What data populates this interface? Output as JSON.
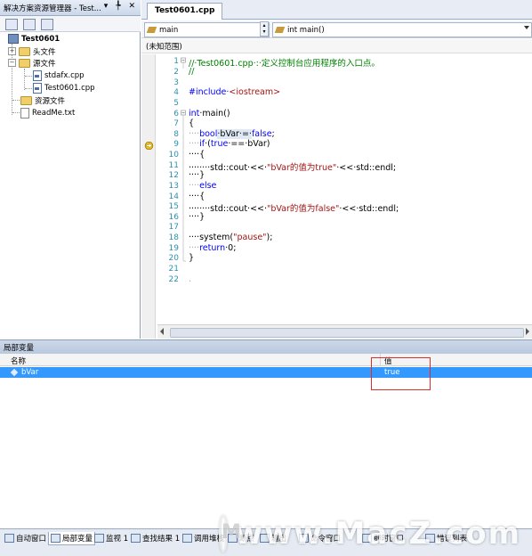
{
  "solution_explorer": {
    "title": "解决方案资源管理器 - Test...",
    "title_buttons": "▾ ╄ ✕",
    "tree": [
      {
        "label": "Test0601"
      },
      {
        "label": "头文件"
      },
      {
        "label": "源文件"
      },
      {
        "label": "stdafx.cpp"
      },
      {
        "label": "Test0601.cpp"
      },
      {
        "label": "资源文件"
      },
      {
        "label": "ReadMe.txt"
      }
    ]
  },
  "editor": {
    "tab_label": "Test0601.cpp",
    "scope_combo": "main",
    "member_combo": "int main()",
    "scope_text": "(未知范围)",
    "lines": [
      "1",
      "2",
      "3",
      "4",
      "5",
      "6",
      "7",
      "8",
      "9",
      "10",
      "11",
      "12",
      "13",
      "14",
      "15",
      "16",
      "17",
      "18",
      "19",
      "20",
      "21",
      "22"
    ],
    "code": {
      "l1": "//·Test0601.cpp·:·定义控制台应用程序的入口点。",
      "l2": "//",
      "l4a": "#include·",
      "l4b": "<iostream>",
      "l6a": "int",
      "l6b": "·main()",
      "l7": "{",
      "l8a": "····",
      "l8b": "bool",
      "l8c": "·bVar·=·",
      "l8d": "false",
      "l8e": ";",
      "l9a": "····",
      "l9b": "if",
      "l9c": "·(",
      "l9d": "true",
      "l9e": "·==·bVar)",
      "l10": "····{",
      "l11a": "········std::cout·<<·",
      "l11b": "\"bVar的值为true\"",
      "l11c": "·<<·std::endl;",
      "l12": "····}",
      "l13a": "····",
      "l13b": "else",
      "l14": "····{",
      "l15a": "········std::cout·<<·",
      "l15b": "\"bVar的值为false\"",
      "l15c": "·<<·std::endl;",
      "l16": "····}",
      "l18a": "····system(",
      "l18b": "\"pause\"",
      "l18c": ");",
      "l19a": "····",
      "l19b": "return",
      "l19c": "·0;",
      "l20": "}",
      "l22": "."
    }
  },
  "locals": {
    "title": "局部变量",
    "col_name": "名称",
    "col_value": "值",
    "rows": [
      {
        "name": "bVar",
        "value": "true"
      }
    ]
  },
  "bottom_tabs": [
    "自动窗口",
    "局部变量",
    "监视 1",
    "查找结果 1",
    "调用堆栈",
    "断点",
    "输出",
    "命令窗口",
    "即时窗口",
    "错误列表"
  ],
  "watermark": {
    "logo": "M",
    "text": "www.MacZ.com"
  },
  "colors": {
    "keyword": "#0000ff",
    "comment": "#008000",
    "string": "#a31515",
    "selection": "#3399ff",
    "annotation_box": "#d9302c"
  }
}
